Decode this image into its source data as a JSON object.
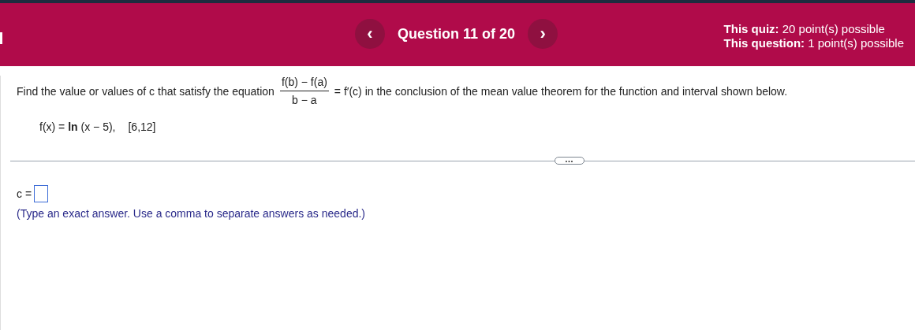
{
  "header": {
    "prev": "‹",
    "title": "Question 11 of 20",
    "next": "›",
    "points": [
      {
        "label": "This quiz:",
        "value": " 20 point(s) possible"
      },
      {
        "label": "This question:",
        "value": " 1 point(s) possible"
      }
    ]
  },
  "question": {
    "before": "Find the value or values of c that satisfy the equation",
    "numerator": "f(b) − f(a)",
    "denominator": "b − a",
    "after": "= f′(c) in the conclusion of the mean value theorem for the function and interval shown below.",
    "function": "f(x) = **ln** (x − 5),",
    "interval": "[6,12]"
  },
  "divider": {
    "handle": "•••"
  },
  "answer": {
    "label": "c =",
    "hint": "(Type an exact answer. Use a comma to separate answers as needed.)"
  }
}
